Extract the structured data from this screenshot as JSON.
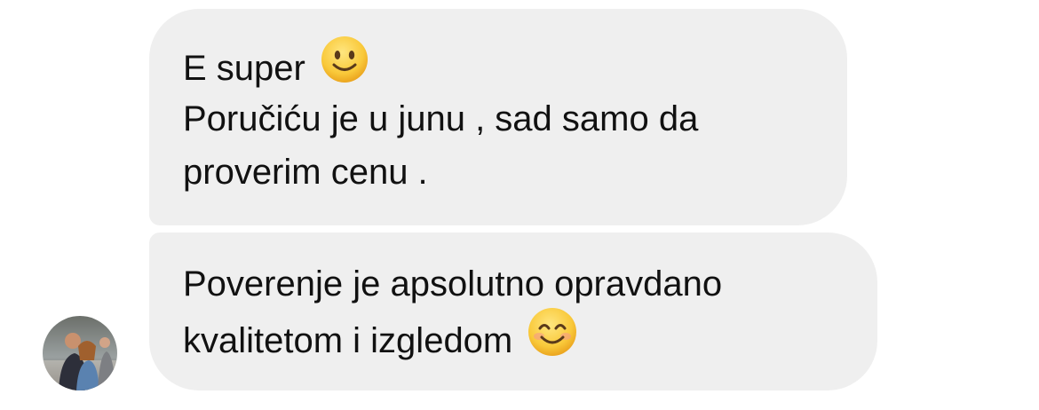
{
  "messages": [
    {
      "lines": [
        {
          "text": "E super",
          "emoji": "slightly-smiling-face-icon"
        },
        {
          "text": "Poručiću je u junu , sad samo da"
        },
        {
          "text": "proverim cenu ."
        }
      ]
    },
    {
      "lines": [
        {
          "text": "Poverenje je apsolutno opravdano"
        },
        {
          "text": "kvalitetom i izgledom",
          "emoji": "smiling-face-with-smiling-eyes-icon"
        }
      ]
    }
  ],
  "colors": {
    "bubble_background": "#efefef",
    "text": "#111111",
    "emoji_yellow": "#f7c531"
  }
}
